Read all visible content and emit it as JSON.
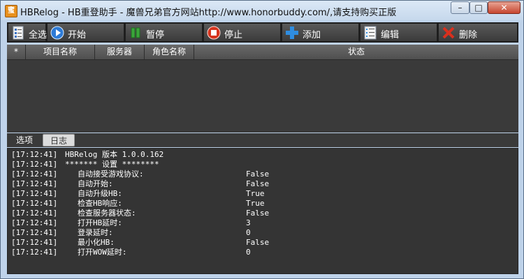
{
  "window": {
    "title": "HBRelog - HB重登助手 - 魔兽兄弟官方网站http://www.honorbuddy.com/,请支持购买正版",
    "icon_text": "蜜",
    "min_glyph": "–",
    "max_glyph": "□",
    "close_glyph": "✕"
  },
  "toolbar": {
    "select_all": "全选",
    "start": "开始",
    "pause": "暂停",
    "stop": "停止",
    "add": "添加",
    "edit": "编辑",
    "delete": "删除"
  },
  "grid": {
    "columns": [
      "*",
      "项目名称",
      "服务器",
      "角色名称",
      "状态"
    ]
  },
  "tabs": {
    "options": "选项",
    "log": "日志"
  },
  "log": [
    {
      "time": "[17:12:41]",
      "key": "HBRelog 版本 1.0.0.162",
      "value": ""
    },
    {
      "time": "[17:12:41]",
      "key": "******* 设置 ********",
      "value": ""
    },
    {
      "time": "[17:12:41]",
      "key": "自动接受游戏协议:",
      "value": "False"
    },
    {
      "time": "[17:12:41]",
      "key": "自动开始:",
      "value": "False"
    },
    {
      "time": "[17:12:41]",
      "key": "自动升级HB:",
      "value": "True"
    },
    {
      "time": "[17:12:41]",
      "key": "检查HB响应:",
      "value": "True"
    },
    {
      "time": "[17:12:41]",
      "key": "检查服务器状态:",
      "value": "False"
    },
    {
      "time": "[17:12:41]",
      "key": "打开HB延时:",
      "value": "3"
    },
    {
      "time": "[17:12:41]",
      "key": "登录延时:",
      "value": "0"
    },
    {
      "time": "[17:12:41]",
      "key": "最小化HB:",
      "value": "False"
    },
    {
      "time": "[17:12:41]",
      "key": "打开WOW延时:",
      "value": "0"
    }
  ]
}
